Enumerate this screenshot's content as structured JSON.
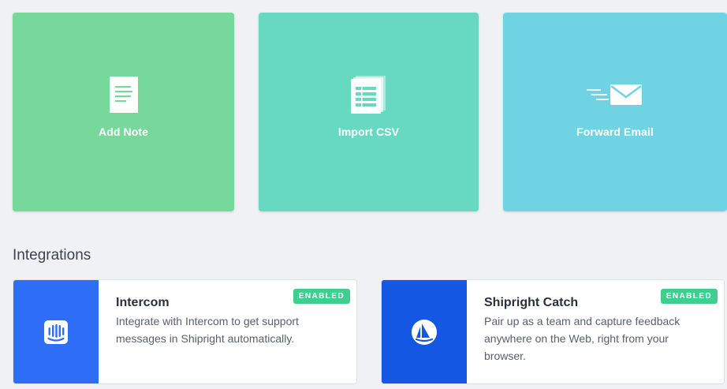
{
  "actions": {
    "add_note": {
      "label": "Add Note",
      "icon": "document-icon",
      "color": "#77d89b"
    },
    "import_csv": {
      "label": "Import CSV",
      "icon": "spreadsheet-icon",
      "color": "#68d9c1"
    },
    "forward_email": {
      "label": "Forward Email",
      "icon": "envelope-icon",
      "color": "#6fd3e3"
    }
  },
  "integrations": {
    "title": "Integrations",
    "items": [
      {
        "name": "Intercom",
        "description": "Integrate with Intercom to get support messages in Shipright automatically.",
        "status": "ENABLED",
        "icon": "intercom-logo-icon",
        "color": "#2e6df6"
      },
      {
        "name": "Shipright Catch",
        "description": "Pair up as a team and capture feedback anywhere on the Web, right from your browser.",
        "status": "ENABLED",
        "icon": "shipright-logo-icon",
        "color": "#1357e3"
      }
    ]
  },
  "colors": {
    "background": "#f0f1f5",
    "badge": "#3ecf8e"
  }
}
